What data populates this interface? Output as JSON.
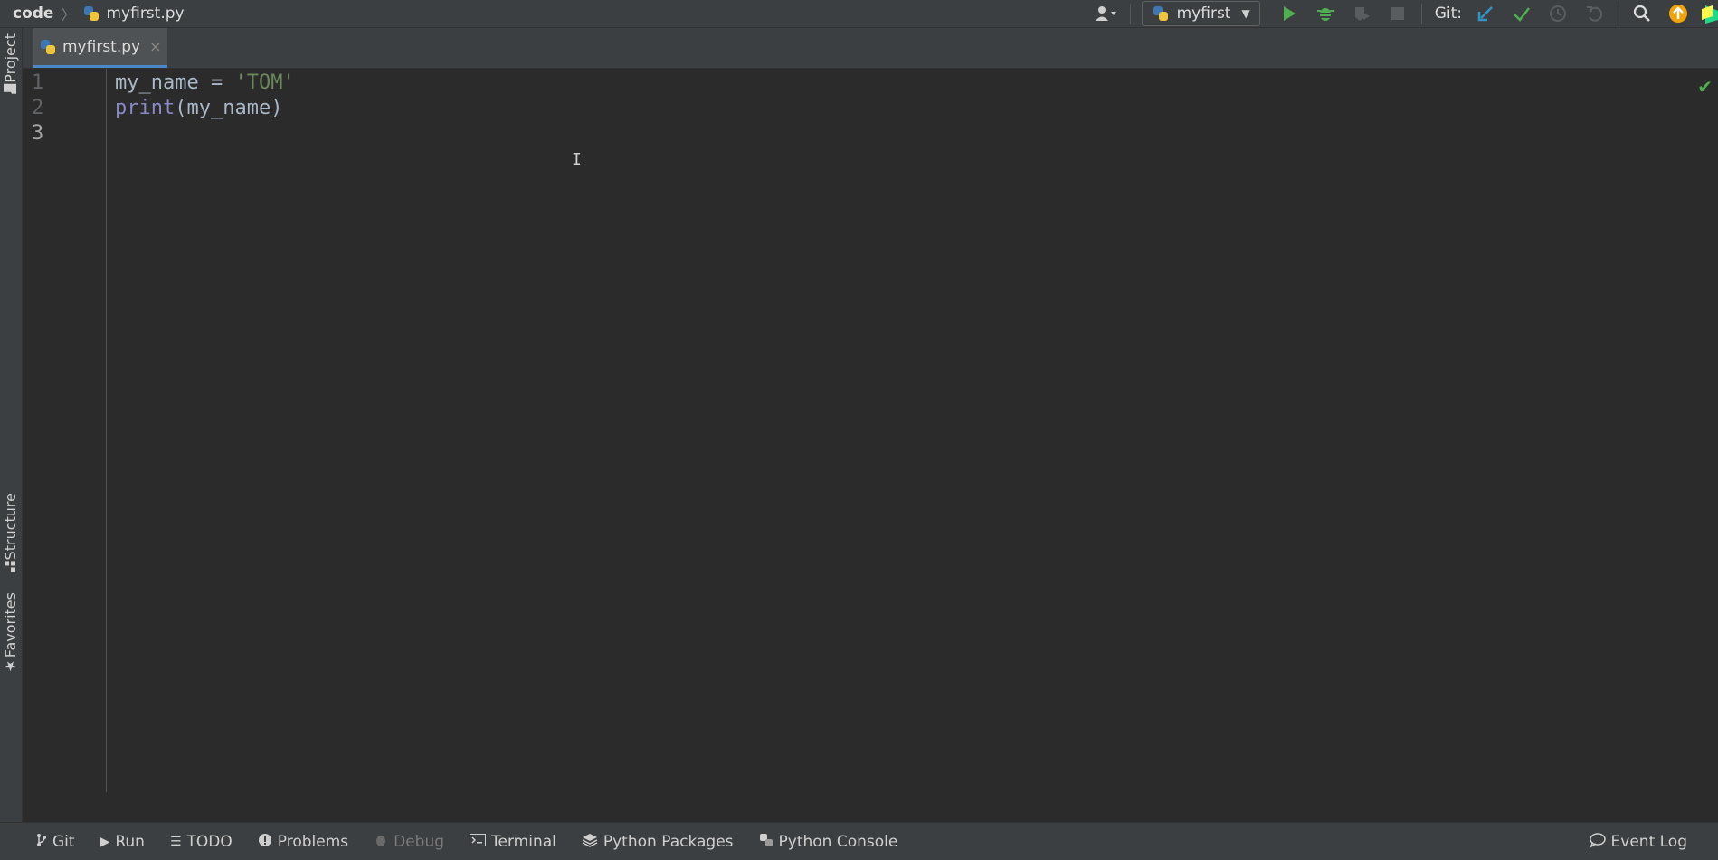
{
  "navbar": {
    "root": "code",
    "file": "myfirst.py",
    "run_config": "myfirst",
    "git_label": "Git:"
  },
  "left_stripe": {
    "project": "Project",
    "structure": "Structure",
    "favorites": "Favorites"
  },
  "tabs": [
    {
      "label": "myfirst.py",
      "close": "×"
    }
  ],
  "editor": {
    "line_numbers": [
      "1",
      "2",
      "3"
    ],
    "line1": {
      "var": "my_name",
      "op": " = ",
      "str": "'TOM'"
    },
    "line2": {
      "func": "print",
      "args": "(my_name)"
    },
    "status_check": "✔",
    "cursor": "I"
  },
  "bottombar": {
    "items": [
      "Git",
      "Run",
      "TODO",
      "Problems",
      "Debug",
      "Terminal",
      "Python Packages",
      "Python Console"
    ],
    "event_log": "Event Log"
  },
  "colors": {
    "background": "#2b2b2b",
    "panel": "#3c3f41",
    "string": "#6a8759",
    "builtin": "#8888c6",
    "identifier": "#a9b7c6",
    "run_green": "#4fae4f",
    "accent_blue": "#4a88c7"
  },
  "icons": {
    "user": "user-icon",
    "run": "run-icon",
    "debug": "debug-icon",
    "coverage": "coverage-icon",
    "stop": "stop-icon",
    "git_update": "git-update-icon",
    "git_commit": "git-commit-icon",
    "git_history": "git-history-icon",
    "git_rollback": "git-rollback-icon",
    "search": "search-icon",
    "updates": "updates-icon"
  }
}
